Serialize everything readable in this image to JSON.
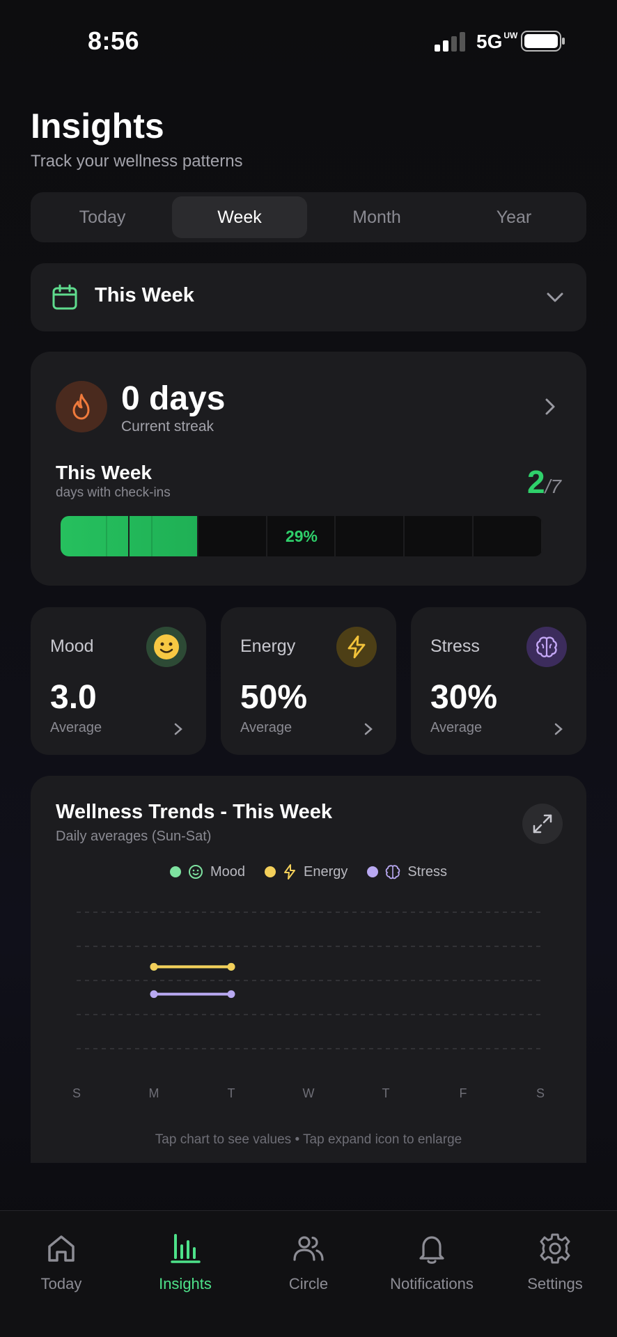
{
  "status_bar": {
    "time": "8:56",
    "network": "5G",
    "network_sup": "UW"
  },
  "header": {
    "title": "Insights",
    "subtitle": "Track your wellness patterns"
  },
  "segments": [
    {
      "label": "Today",
      "active": false
    },
    {
      "label": "Week",
      "active": true
    },
    {
      "label": "Month",
      "active": false
    },
    {
      "label": "Year",
      "active": false
    }
  ],
  "period_selector": {
    "label": "This Week",
    "icon": "calendar-icon"
  },
  "streak": {
    "value": "0 days",
    "label": "Current streak",
    "week_title": "This Week",
    "week_subtitle": "days with check-ins",
    "count": "2",
    "total": "/7",
    "progress_label": "29%",
    "progress_fraction": 0.2857,
    "accent_color": "#2fd06b"
  },
  "metrics": [
    {
      "title": "Mood",
      "value": "3.0",
      "subtitle": "Average",
      "icon": "smiley-icon",
      "color": "#2d4a35"
    },
    {
      "title": "Energy",
      "value": "50%",
      "subtitle": "Average",
      "icon": "lightning-icon",
      "color": "#4d3f16"
    },
    {
      "title": "Stress",
      "value": "30%",
      "subtitle": "Average",
      "icon": "brain-icon",
      "color": "#3c2c5c"
    }
  ],
  "chart": {
    "title": "Wellness Trends - This Week",
    "subtitle": "Daily averages (Sun-Sat)",
    "hint": "Tap chart to see values • Tap expand icon to enlarge",
    "legend": [
      {
        "label": "Mood",
        "color": "#7ee2a0"
      },
      {
        "label": "Energy",
        "color": "#f3cf5a"
      },
      {
        "label": "Stress",
        "color": "#b9a9f2"
      }
    ]
  },
  "chart_data": {
    "type": "line",
    "title": "Wellness Trends - This Week",
    "subtitle": "Daily averages (Sun-Sat)",
    "categories": [
      "S",
      "M",
      "T",
      "W",
      "T",
      "F",
      "S"
    ],
    "ylim": [
      0,
      100
    ],
    "grid": true,
    "legend_position": "top-center",
    "series": [
      {
        "name": "Mood",
        "color": "#7ee2a0",
        "values": [
          null,
          60,
          60,
          null,
          null,
          null,
          null
        ]
      },
      {
        "name": "Energy",
        "color": "#f3cf5a",
        "values": [
          null,
          60,
          60,
          null,
          null,
          null,
          null
        ]
      },
      {
        "name": "Stress",
        "color": "#b9a9f2",
        "values": [
          null,
          40,
          40,
          null,
          null,
          null,
          null
        ]
      }
    ]
  },
  "tabbar": [
    {
      "label": "Today",
      "icon": "home-icon",
      "active": false
    },
    {
      "label": "Insights",
      "icon": "bar-chart-icon",
      "active": true
    },
    {
      "label": "Circle",
      "icon": "people-icon",
      "active": false
    },
    {
      "label": "Notifications",
      "icon": "bell-icon",
      "active": false
    },
    {
      "label": "Settings",
      "icon": "gear-icon",
      "active": false
    }
  ]
}
